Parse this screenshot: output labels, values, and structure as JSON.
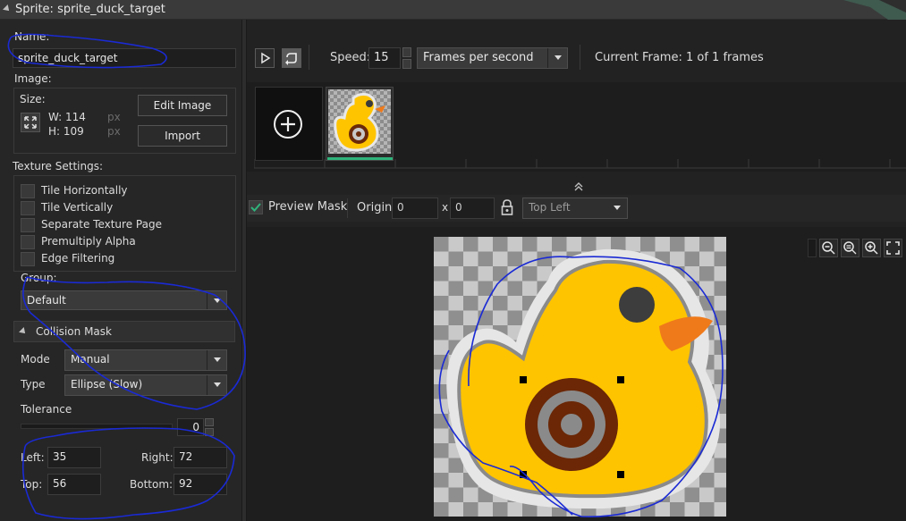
{
  "window": {
    "title": "Sprite: sprite_duck_target"
  },
  "left": {
    "name_label": "Name:",
    "name_value": "sprite_duck_target",
    "image_label": "Image:",
    "size_label": "Size:",
    "width_label": "W: 114",
    "height_label": "H: 109",
    "px_unit": "px",
    "edit_image": "Edit Image",
    "import": "Import",
    "texture_settings": "Texture Settings:",
    "options": [
      "Tile Horizontally",
      "Tile Vertically",
      "Separate Texture Page",
      "Premultiply Alpha",
      "Edge Filtering"
    ],
    "group_label": "Group:",
    "group_value": "Default",
    "collision_mask": "Collision Mask",
    "mode_label": "Mode",
    "mode_value": "Manual",
    "type_label": "Type",
    "type_value": "Ellipse (Slow)",
    "tolerance_label": "Tolerance",
    "tolerance_value": "0",
    "left_label": "Left:",
    "left_value": "35",
    "right_label": "Right:",
    "right_value": "72",
    "top_label": "Top:",
    "top_value": "56",
    "bottom_label": "Bottom:",
    "bottom_value": "92"
  },
  "toolbar": {
    "speed_label": "Speed:",
    "speed_value": "15",
    "speed_unit": "Frames per second",
    "current_frame": "Current Frame: 1 of 1 frames"
  },
  "mask": {
    "preview_label": "Preview Mask",
    "preview_checked": true,
    "origin_label": "Origin:",
    "origin_x": "0",
    "origin_y": "0",
    "x_sep": "x",
    "origin_preset": "Top Left"
  },
  "colors": {
    "accent": "#2fb37b",
    "duck": "#ffc400",
    "beak": "#ef7a1a",
    "annotation": "#1a2ad4"
  },
  "icons": [
    "play-icon",
    "loop-icon",
    "add-icon",
    "lock-icon",
    "zoom-out-icon",
    "zoom-reset-icon",
    "zoom-in-icon",
    "fullscreen-icon",
    "collapse-icon"
  ]
}
